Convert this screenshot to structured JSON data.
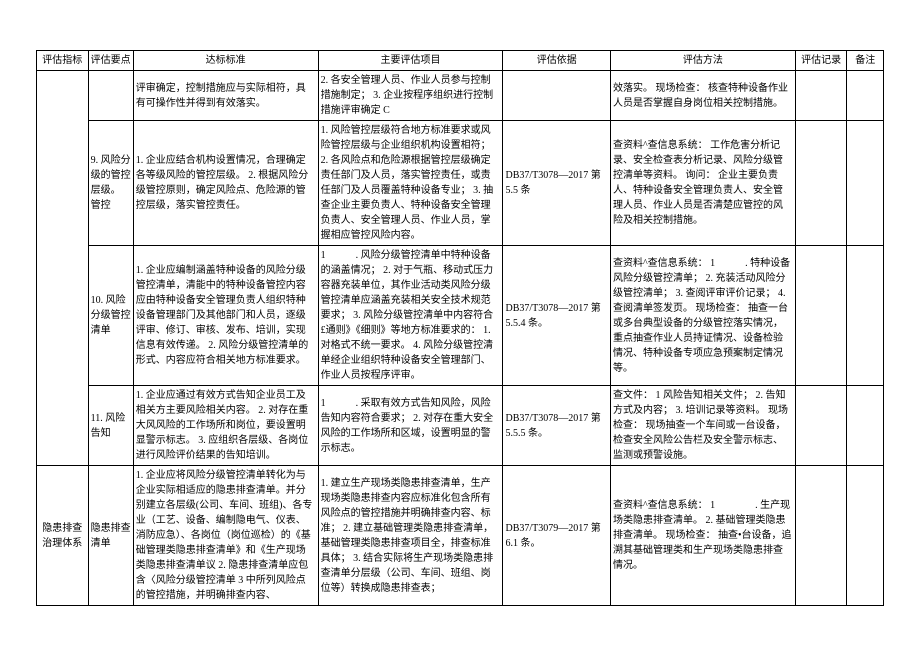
{
  "header": {
    "c1": "评估指标",
    "c2": "评估要点",
    "c3": "达标标准",
    "c4": "主要评估项目",
    "c5": "评估依据",
    "c6": "评估方法",
    "c7": "评估记录",
    "c8": "备注"
  },
  "rows": [
    {
      "key": "",
      "std": "评审确定，控制措施应与实际相符，具有可操作性并得到有效落实。",
      "proj": "2. 各安全管理人员、作业人员参与控制措施制定；\n3. 企业按程序组织进行控制措施评审确定 C",
      "basis": "",
      "method": "效落实。\n现场检查：\n核查特种设备作业人员是否掌握自身岗位相关控制措施。"
    },
    {
      "key": "9. 风险分级的管控层级。\n管控",
      "std": "1. 企业应结合机构设置情况，合理确定各等级风险的管控层级。\n2. 根据风险分级管控原则，确定风险点、危险源的管控层级，落实管控责任。",
      "proj": "1. 风险管控层级符合地方标准要求或风险管控层级与企业组织机构设置相符；\n2. 各风险点和危险源根据管控层级确定责任部门及人员，落实管控责任，或责任部门及人员覆盖特种设备专业；\n3. 抽查企业主要负责人、特种设备安全管理负责人、安全管理人员、作业人员，掌握相应管控风险内容。",
      "basis": "DB37/T3078—2017 第 5.5 条",
      "method": "查资料^查信息系统：\n工作危害分析记录、安全检查表分析记录、风险分级管控清单等资料。\n询问：\n企业主要负责人、特种设备安全管理负责人、安全管理人员、作业人员是否清楚应管控的风险及相关控制措施。"
    },
    {
      "key": "10. 风险分级管控清单",
      "std": "1. 企业应编制涵盖特种设备的风险分级管控清单，清能中的特种设备管控内容应由特种设备安全管理负责人组织特种设备管理部门及其他部门和人员，逐级评审、修订、审核、发布、培训，实现信息有效传递。\n2. 风险分级管控清单的形式、内容应符合相关地方标准要求。",
      "proj": "1　　　. 风险分级管控清单中特种设备的涵盖情况；\n2. 对于气瓶、移动式压力容器充装单位，其作业活动类风险分级管控清单应涵盖充装相关安全技术规范要求；\n3. 风险分级管控清单中内容符合£通则》《细则》等地方标准要求的：\n1. 对格式不统一要求。\n4. 风险分级管控清单经企业组织特种设备安全管理部门、作业人员按程序评审。",
      "basis": "DB37/T3078—2017 第 5.5.4 条。",
      "method": "查资料^查信息系统：\n1　　　. 特种设备风险分级管控清单；\n2. 充装活动风险分级管控清单；\n3. 查阅评审评价记录；\n4. 查阅清单签发页。\n现场检查：\n抽查一台或多台典型设备的分级管控落实情况，重点抽查作业人员持证情况、设备检验情况、特种设备专项应急预案制定情况等。"
    },
    {
      "key": "11. 风险告知",
      "std": "1. 企业应通过有效方式告知企业员工及相关方主要风险相关内容。\n2. 对存在重大风风险的工作场所和岗位，要设置明显警示标志。\n3. 应组织各层级、各岗位进行风险评价结果的告知培训。",
      "proj": "1　　　. 采取有效方式告知风险，风险告知内容符合要求；\n2. 对存在重大安全风险的工作场所和区域，设置明显的警示标志。",
      "basis": "DB37/T3078—2017 第 5.5.5 条。",
      "method": "查文件：\n1 风险告知相关文件；\n2. 告知方式及内容；\n3. 培训记录等资料。\n现场检查：\n现场抽查一个车间或一台设备，检查安全风险公告栏及安全警示标志、监测或预警设施。"
    },
    {
      "ind": "隐患排查治理体系",
      "key": "隐患排查清单",
      "std": "1. 企业应将风险分级管控清单转化为与企业实际相适应的隐患排查清单。并分别建立各层级(公司、车间、班组)、各专业（工艺、设备、编制隐电气、仪表、消防应急）、各岗位（岗位巡检）的《基础管理类隐患排查清单》和《生产现场类隐患排查清单议\n2. 隐患排查清单应包含〈风险分级管控清单 3 中所列风险点的管控措施，并明确排查内容、",
      "proj": "1. 建立生产现场类隐患排查清单，生产现场类隐患排查内容应标准化包含所有风险点的管控措施并明确排查内容、标准；\n2. 建立基础管理类隐患排查清单，基础管理类隐患排查项目全，排查标准具体；\n3. 结合实际将生产现场类隐患排查清单分层级（公司、车间、班组、岗位等）转换成隐患排查表；",
      "basis": "DB37/T3079—2017 第 6.1 条。",
      "method": "查资料^查信息系统：\n1　　　　. 生产现场类隐患排查清单。\n2. 基础管理类隐患排查清单。\n现场检查：\n抽查•台设备，追溯其基础管理类和生产现场类隐患排查情况。"
    }
  ]
}
